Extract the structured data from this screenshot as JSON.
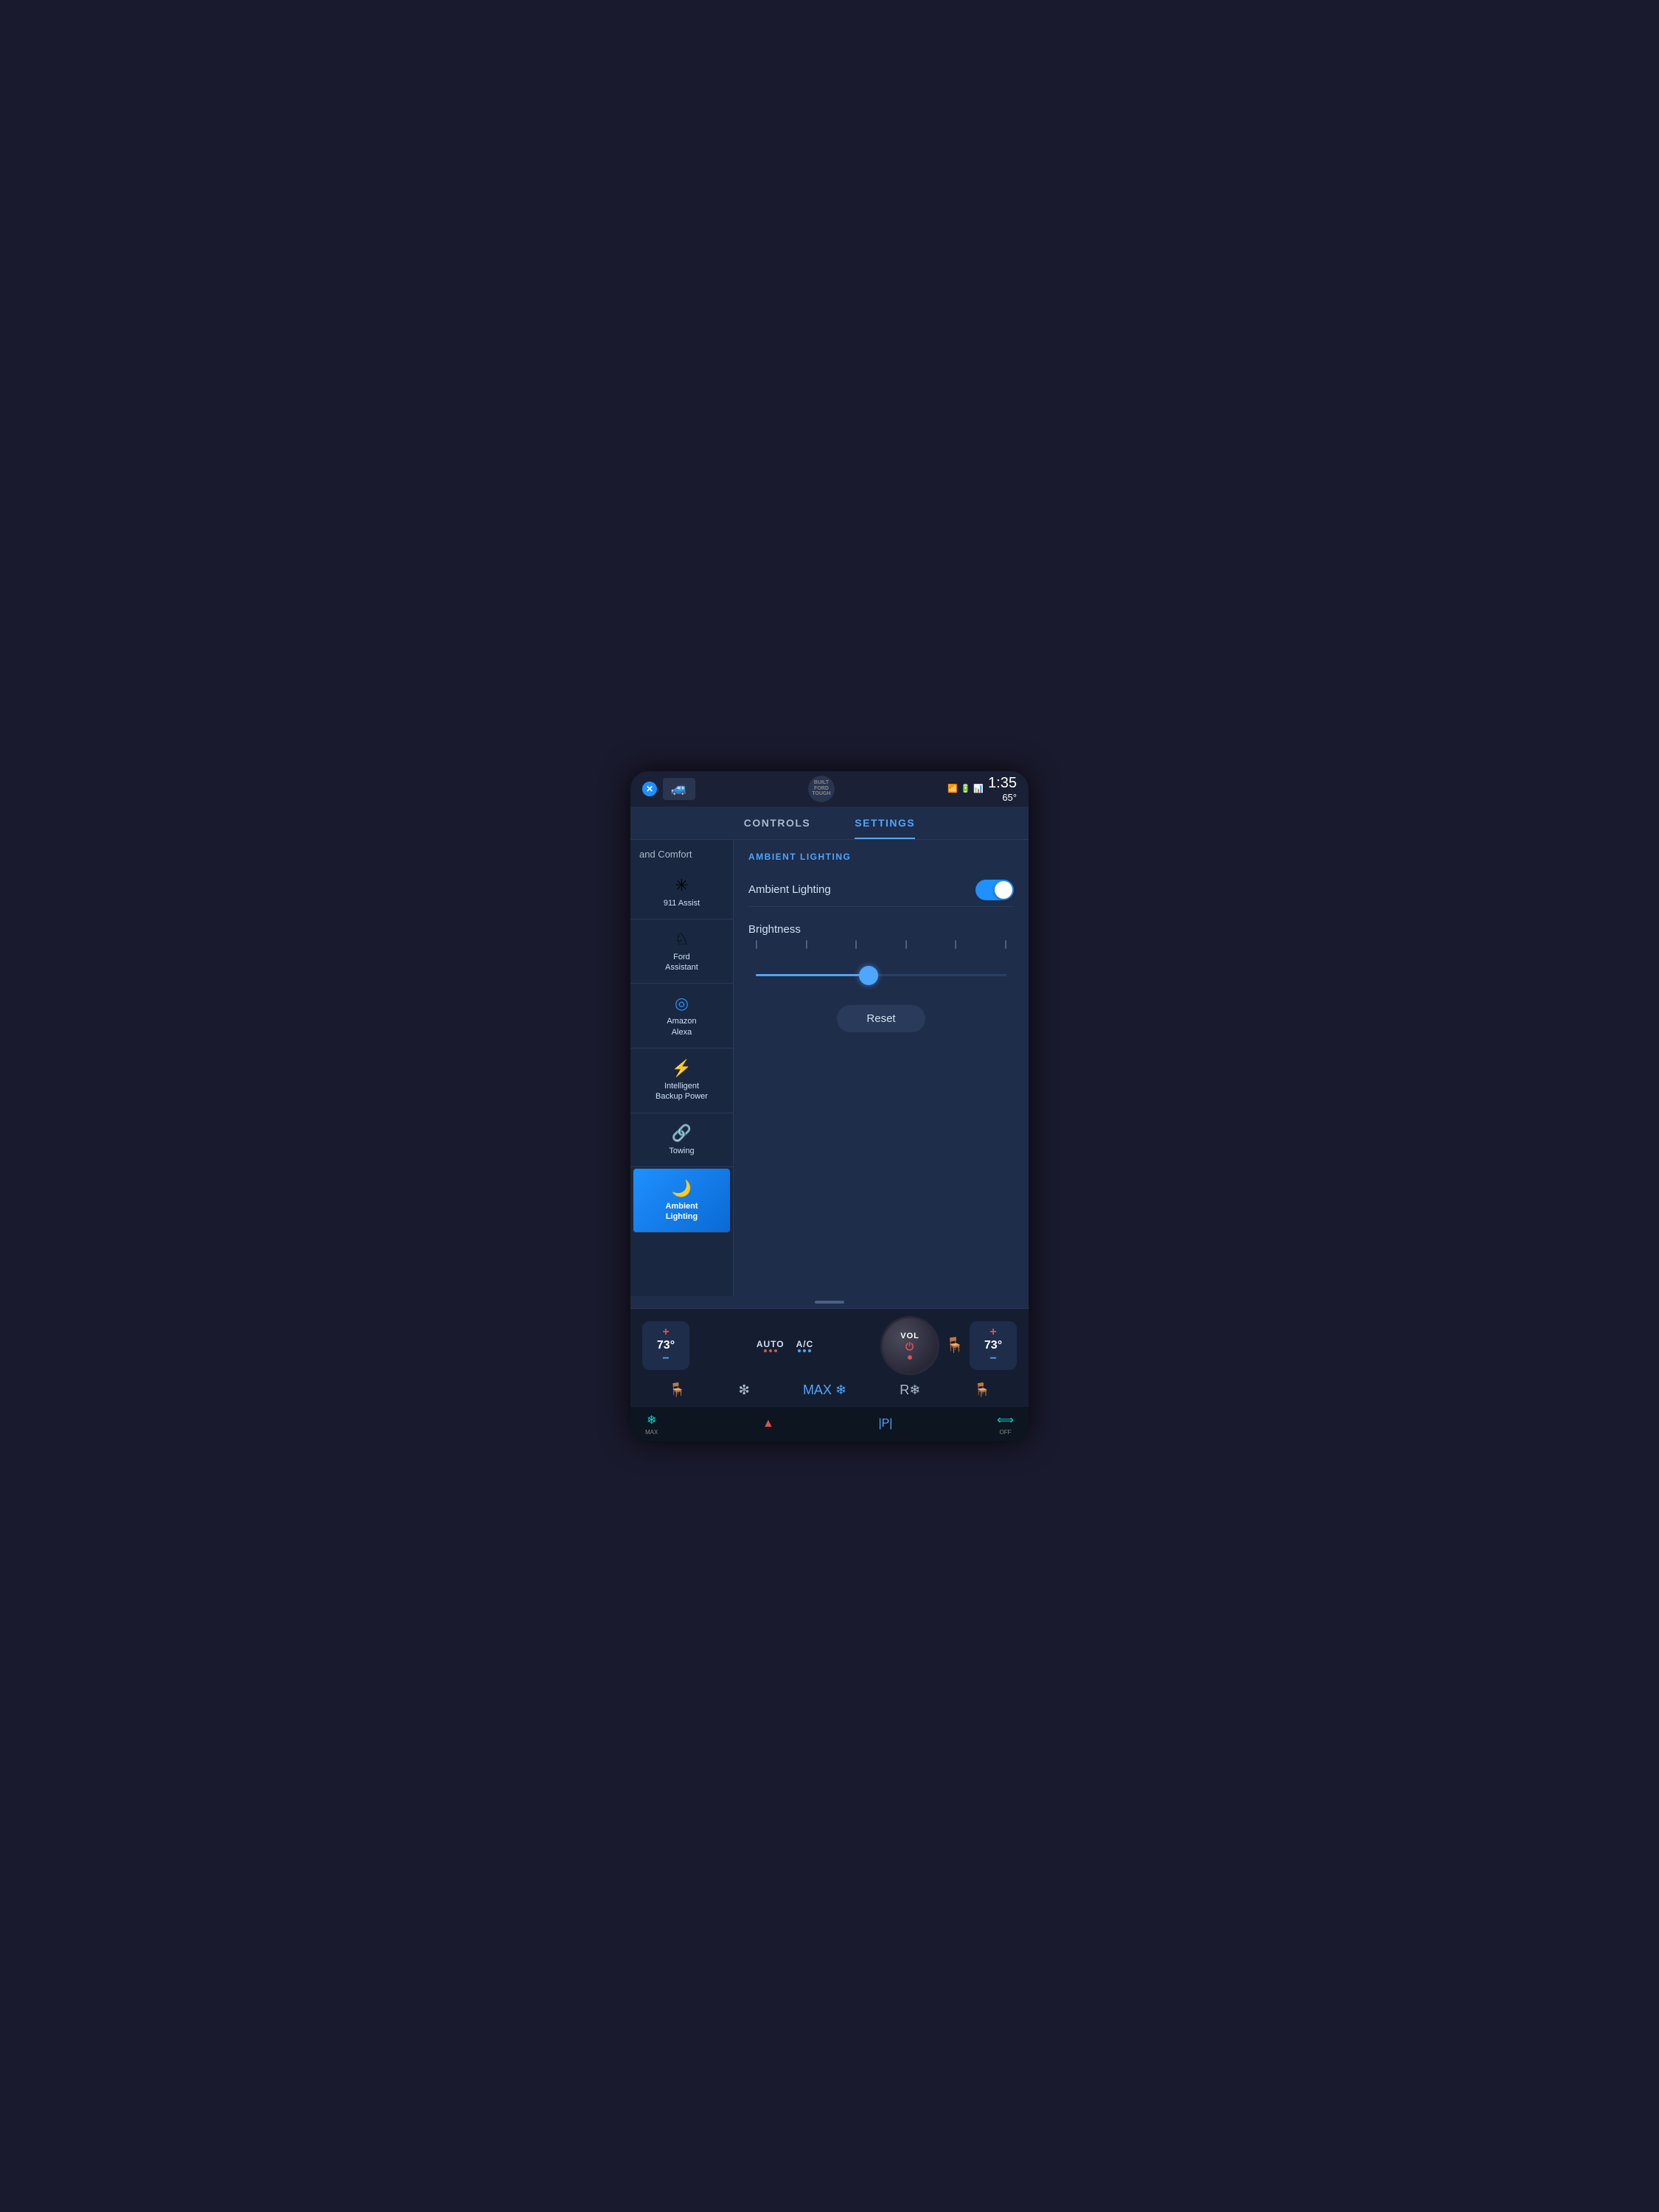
{
  "statusBar": {
    "time": "1:35",
    "temperature": "65°",
    "builtLabel": "BUILT\nFORD\nTOUGH"
  },
  "tabs": [
    {
      "id": "controls",
      "label": "CONTROLS",
      "active": false
    },
    {
      "id": "settings",
      "label": "SETTINGS",
      "active": true
    }
  ],
  "sidebar": {
    "sectionLabel": "and Comfort",
    "items": [
      {
        "id": "911-assist",
        "icon": "✳",
        "label": "911 Assist"
      },
      {
        "id": "ford-assistant",
        "icon": "🔧",
        "label": "Ford\nAssistant"
      },
      {
        "id": "amazon-alexa",
        "icon": "◎",
        "label": "Amazon\nAlexa"
      },
      {
        "id": "intelligent-backup",
        "icon": "⚡",
        "label": "Intelligent\nBackup Power"
      },
      {
        "id": "towing",
        "icon": "🚗",
        "label": "Towing"
      },
      {
        "id": "ambient-lighting",
        "icon": "💡",
        "label": "Ambient\nLighting",
        "active": true
      }
    ]
  },
  "mainPanel": {
    "sectionTitle": "AMBIENT LIGHTING",
    "settings": [
      {
        "id": "ambient-lighting-toggle",
        "label": "Ambient Lighting",
        "type": "toggle",
        "value": true
      }
    ],
    "brightnessLabel": "Brightness",
    "sliderValue": 45,
    "tickCount": 6,
    "resetButton": "Reset"
  },
  "climateBar": {
    "leftTemp": "73°",
    "rightTemp": "73°",
    "autoLabel": "AUTO",
    "acLabel": "A/C",
    "volLabel": "VOL",
    "seatHeatIcon": "🪑"
  },
  "physicalBar": {
    "buttons": [
      {
        "id": "max-defrost",
        "icon": "❄",
        "label": "MAX",
        "color": "cyan"
      },
      {
        "id": "hazard",
        "icon": "▲",
        "color": "red"
      },
      {
        "id": "park",
        "icon": "|P|",
        "color": "default"
      },
      {
        "id": "lane-off",
        "icon": "⟺",
        "label": "OFF",
        "color": "cyan"
      }
    ]
  }
}
